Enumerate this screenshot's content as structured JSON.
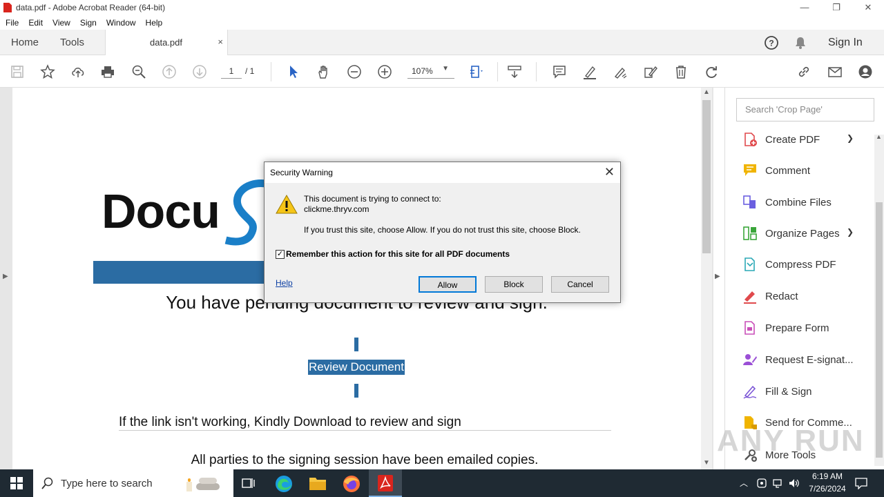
{
  "window": {
    "title": "data.pdf - Adobe Acrobat Reader (64-bit)",
    "minimize": "—",
    "restore": "❐",
    "close": "✕"
  },
  "menu": [
    "File",
    "Edit",
    "View",
    "Sign",
    "Window",
    "Help"
  ],
  "tabs": {
    "home": "Home",
    "tools": "Tools",
    "doc": "data.pdf",
    "doc_close": "×",
    "signin": "Sign In"
  },
  "toolbar": {
    "page_current": "1",
    "page_total": "/ 1",
    "zoom": "107%"
  },
  "document": {
    "logo_text": "Docu",
    "heading": "You have pending document to review and sign.",
    "review_button": "Review Document",
    "link_text": "If the link isn't working, Kindly Download to review and sign",
    "footer_text": "All parties to the signing session have been emailed copies."
  },
  "dialog": {
    "title": "Security Warning",
    "line1": "This document is trying to connect to:",
    "site": "clickme.thryv.com",
    "line2": "If you trust this site, choose Allow. If you do not trust this site, choose Block.",
    "remember": "Remember this action for this site for all PDF documents",
    "remember_checked": true,
    "help": "Help",
    "allow": "Allow",
    "block": "Block",
    "cancel": "Cancel"
  },
  "right_panel": {
    "search_placeholder": "Search 'Crop Page'",
    "items": [
      {
        "label": "Create PDF",
        "icon": "create-pdf-icon",
        "color": "#e0494c"
      },
      {
        "label": "Comment",
        "icon": "comment-icon",
        "color": "#f0b400"
      },
      {
        "label": "Combine Files",
        "icon": "combine-files-icon",
        "color": "#6b5fe0"
      },
      {
        "label": "Organize Pages",
        "icon": "organize-pages-icon",
        "color": "#3aa63a"
      },
      {
        "label": "Compress PDF",
        "icon": "compress-pdf-icon",
        "color": "#2aa8b5"
      },
      {
        "label": "Redact",
        "icon": "redact-icon",
        "color": "#e0494c"
      },
      {
        "label": "Prepare Form",
        "icon": "prepare-form-icon",
        "color": "#c94fb8"
      },
      {
        "label": "Request E-signat...",
        "icon": "request-esign-icon",
        "color": "#9b4fd6"
      },
      {
        "label": "Fill & Sign",
        "icon": "fill-sign-icon",
        "color": "#7b55d6"
      },
      {
        "label": "Send for Comme...",
        "icon": "send-comment-icon",
        "color": "#f0b400"
      },
      {
        "label": "More Tools",
        "icon": "more-tools-icon",
        "color": "#555555"
      }
    ]
  },
  "watermark": "ANY RUN",
  "taskbar": {
    "search_placeholder": "Type here to search",
    "time": "6:19 AM",
    "date": "7/26/2024"
  }
}
